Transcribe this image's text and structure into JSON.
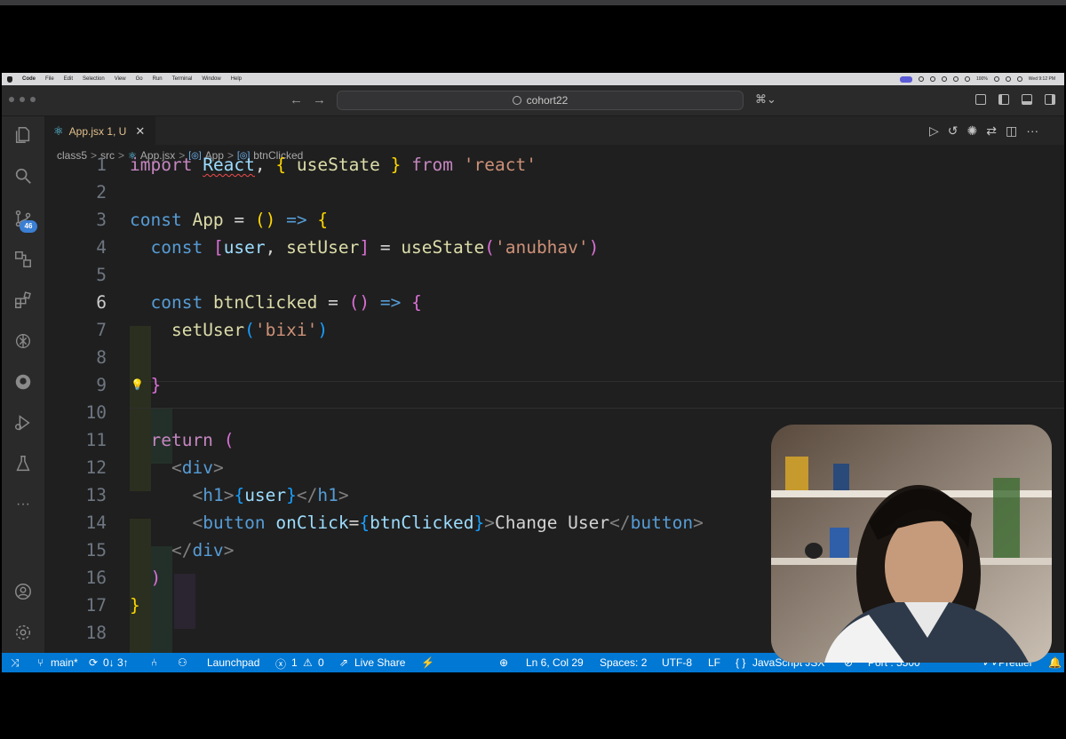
{
  "menubar": {
    "app": "Code",
    "items": [
      "File",
      "Edit",
      "Selection",
      "View",
      "Go",
      "Run",
      "Terminal",
      "Window",
      "Help"
    ],
    "battery": "100%",
    "clock": "Wed 9:12 PM"
  },
  "titlebar": {
    "search_text": "cohort22"
  },
  "activity": {
    "source_control_badge": "46"
  },
  "tab": {
    "label": "App.jsx 1, U",
    "close": "✕"
  },
  "breadcrumb": {
    "items": [
      "class5",
      "src",
      "App.jsx",
      "App",
      "btnClicked"
    ]
  },
  "editor": {
    "line_numbers": [
      "1",
      "2",
      "3",
      "4",
      "5",
      "6",
      "7",
      "8",
      "9",
      "10",
      "11",
      "12",
      "13",
      "14",
      "15",
      "16",
      "17",
      "18"
    ],
    "lines": [
      "import React, { useState } from 'react'",
      "",
      "const App = () => {",
      "  const [user, setUser] = useState('anubhav')",
      "",
      "  const btnClicked = () => {",
      "    setUser('bixi')",
      "",
      "  }",
      "",
      "  return (",
      "    <div>",
      "      <h1>{user}</h1>",
      "      <button onClick={btnClicked}>Change User</button>",
      "    </div>",
      "  )",
      "}",
      ""
    ]
  },
  "statusbar": {
    "branch": "main*",
    "sync": "0↓ 3↑",
    "launchpad": "Launchpad",
    "errors": "1",
    "warnings": "0",
    "live_share": "Live Share",
    "position": "Ln 6, Col 29",
    "spaces": "Spaces: 2",
    "encoding": "UTF-8",
    "eol": "LF",
    "language": "JavaScript JSX",
    "port": "Port : 5500",
    "prettier": "Prettier"
  },
  "colors": {
    "status_bar": "#0078d4",
    "editor_bg": "#1f1f1f"
  }
}
